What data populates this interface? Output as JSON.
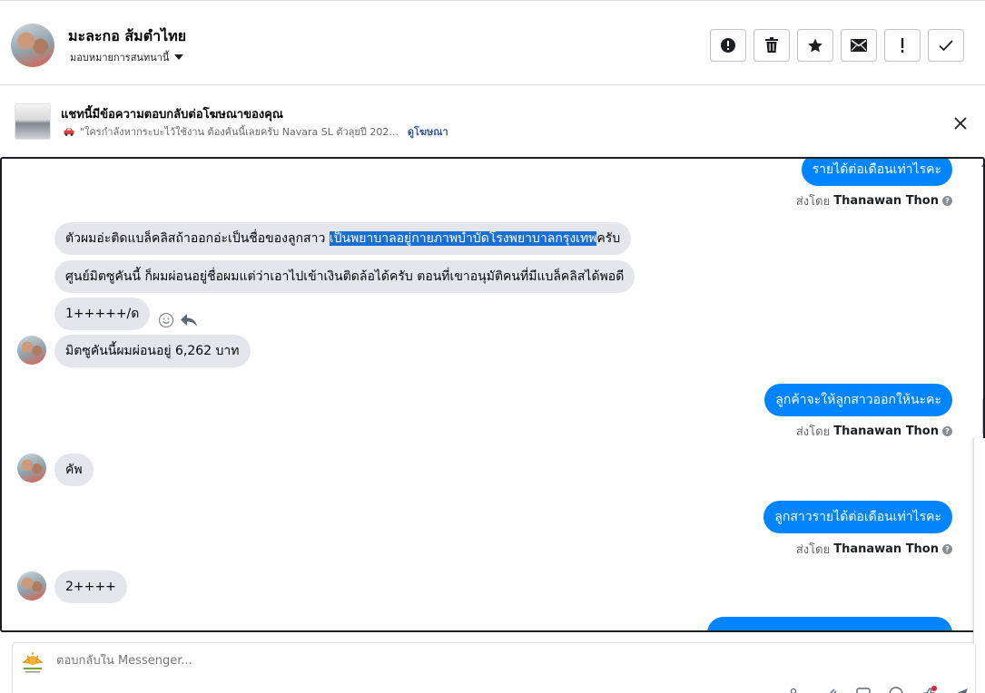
{
  "header": {
    "contact_name": "มะละกอ ส้มตำไทย",
    "assign_label": "มอบหมายการสนทนานี้",
    "toolbar": [
      "report-icon",
      "trash-icon",
      "star-icon",
      "envelope-icon",
      "exclamation-icon",
      "check-icon"
    ]
  },
  "ad_banner": {
    "title": "แชทนี้มีข้อความตอบกลับต่อโฆษณาของคุณ",
    "ad_text": "\"ใครกำลังหากระบะไว้ใช้งาน ต้องคันนี้เลยครับ Navara SL ตัวลุยปี 202...",
    "link": "ดูโฆษณา"
  },
  "messages": {
    "out1": "รายได้ต่อเดือนเท่าไรคะ",
    "in1_before": "ตัวผมอ่ะติดแบล็คลิสถ้าออกอ่ะเป็นชื่อของลูกสาว ",
    "in1_highlight": "เป็นพยาบาลอยู่กายภาพบำบัดโรงพยาบาลกรุงเทพ",
    "in1_after": "ครับ",
    "in2": "ศูนย์มิตซูคันนี้ ก็ผมผ่อนอยู่ชื่อผมแต่ว่าเอาไปเข้าเงินติดล้อได้ครับ ตอนที่เขาอนุมัติคนที่มีแบล็คลิสได้พอดี",
    "in3": "1+++++/ด",
    "in4": "มิตซูคันนี้ผมผ่อนอยู่ 6,262 บาท",
    "out2": "ลูกค้าจะให้ลูกสาวออกให้นะคะ",
    "in5": "คัพ",
    "out3": "ลูกสาวรายได้ต่อเดือนเท่าไรคะ",
    "in6": "2++++"
  },
  "sent_by": {
    "prefix": "ส่งโดย",
    "name": "Thanawan Thon"
  },
  "composer": {
    "placeholder": "ตอบกลับใน Messenger..."
  },
  "colors": {
    "outgoing_bubble": "#0084ff",
    "incoming_bubble": "#e4e6eb",
    "highlight": "#1a6fd4",
    "link": "#385898"
  }
}
